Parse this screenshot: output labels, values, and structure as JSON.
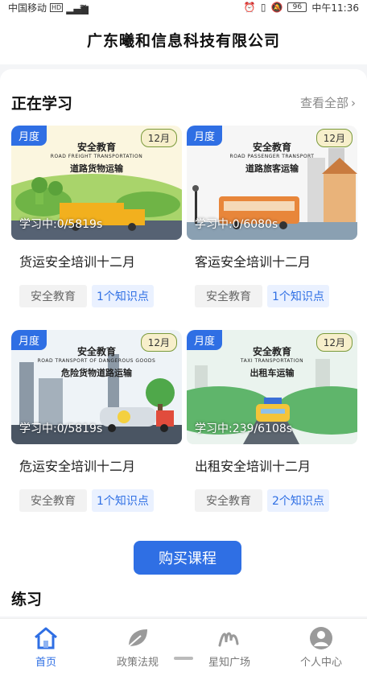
{
  "status": {
    "carrier": "中国移动",
    "net": "HD",
    "battery": "96",
    "time": "中午11:36"
  },
  "header": {
    "title": "广东曦和信息科技有限公司"
  },
  "learning": {
    "title": "正在学习",
    "view_all": "查看全部"
  },
  "courses": [
    {
      "badge": "月度",
      "month": "12月",
      "heading": "安全教育",
      "subheading_en": "ROAD FREIGHT TRANSPORTATION",
      "subheading": "道路货物运输",
      "progress": "学习中:0/5819s",
      "title": "货运安全培训十二月",
      "category": "安全教育",
      "points": "1个知识点"
    },
    {
      "badge": "月度",
      "month": "12月",
      "heading": "安全教育",
      "subheading_en": "ROAD PASSENGER TRANSPORT",
      "subheading": "道路旅客运输",
      "progress": "学习中:0/6080s",
      "title": "客运安全培训十二月",
      "category": "安全教育",
      "points": "1个知识点"
    },
    {
      "badge": "月度",
      "month": "12月",
      "heading": "安全教育",
      "subheading_en": "ROAD TRANSPORT OF DANGEROUS GOODS",
      "subheading": "危险货物道路运输",
      "progress": "学习中:0/5819s",
      "title": "危运安全培训十二月",
      "category": "安全教育",
      "points": "1个知识点"
    },
    {
      "badge": "月度",
      "month": "12月",
      "heading": "安全教育",
      "subheading_en": "TAXI TRANSPORTATION",
      "subheading": "出租车运输",
      "progress": "学习中:239/6108s",
      "title": "出租安全培训十二月",
      "category": "安全教育",
      "points": "2个知识点"
    }
  ],
  "buy_button": "购买课程",
  "practice_title": "练习",
  "tabs": [
    {
      "label": "首页",
      "icon": "home-icon"
    },
    {
      "label": "政策法规",
      "icon": "leaf-icon"
    },
    {
      "label": "星知广场",
      "icon": "squiggle-icon"
    },
    {
      "label": "个人中心",
      "icon": "user-icon"
    }
  ],
  "colors": {
    "accent": "#2f6fe4",
    "background": "#f4f5f7"
  }
}
